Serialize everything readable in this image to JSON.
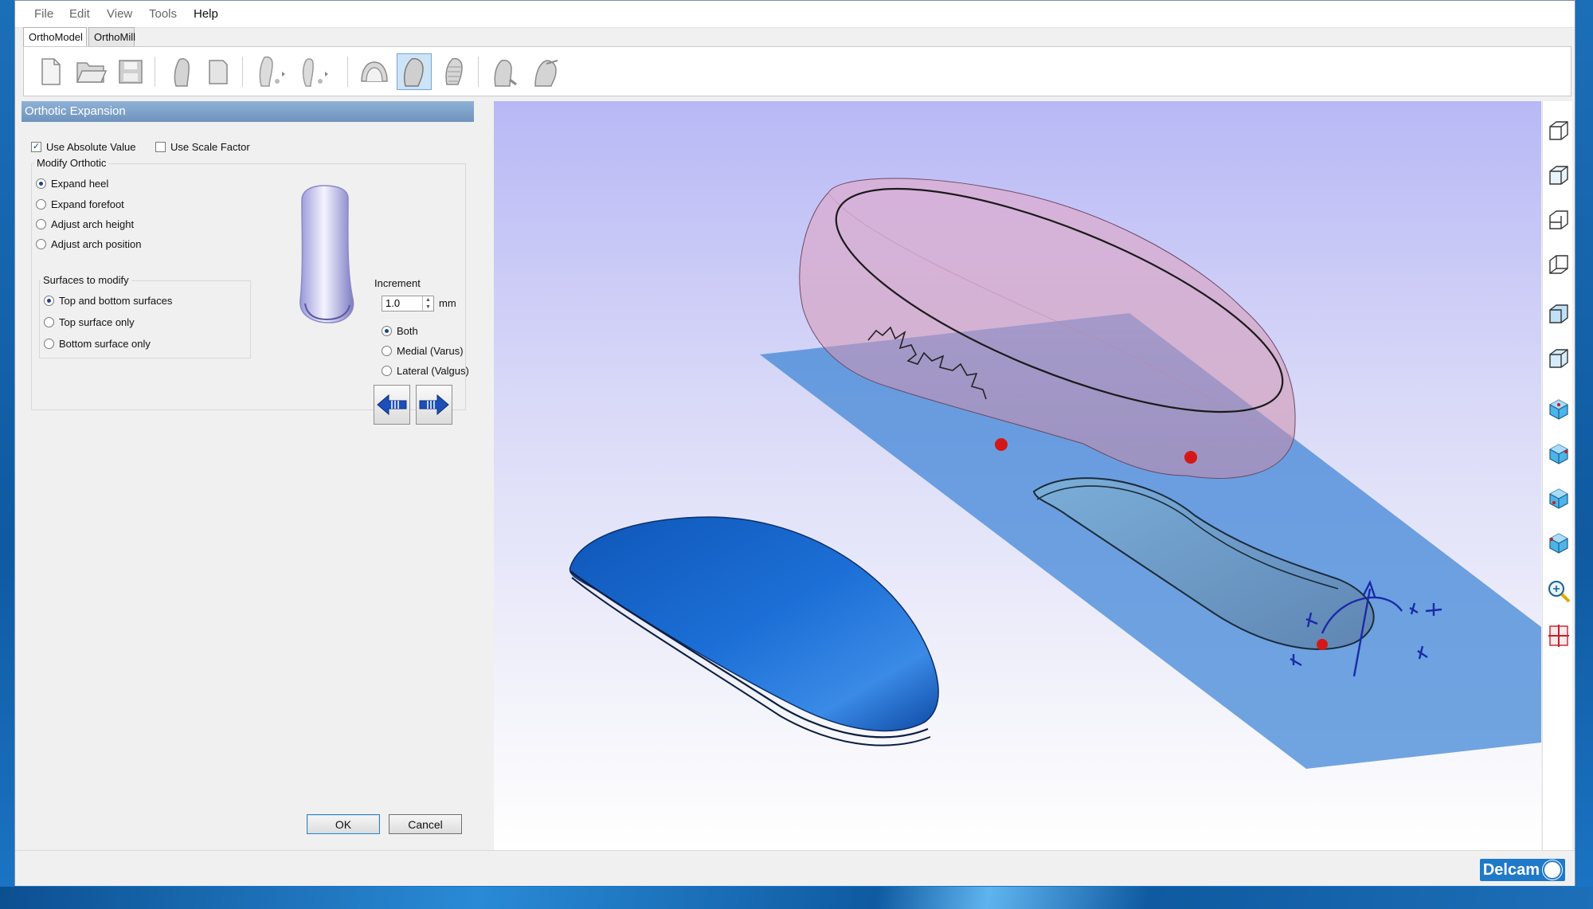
{
  "menu": {
    "items": [
      "File",
      "Edit",
      "View",
      "Tools",
      "Help"
    ]
  },
  "tabs": [
    "OrthoModel",
    "OrthoMill"
  ],
  "toolbar": {
    "buttons": [
      "new-file-icon",
      "open-folder-icon",
      "save-icon",
      "foot-scan-icon",
      "page-icon",
      "foot-side-icon",
      "foot-sole-icon",
      "shell-icon",
      "orthotic-icon",
      "orthotic-grid-icon",
      "heel-tool-icon",
      "heel-post-icon"
    ],
    "active": "orthotic-icon"
  },
  "panel": {
    "title": "Orthotic Expansion",
    "use_absolute_value": {
      "label": "Use Absolute Value",
      "checked": true
    },
    "use_scale_factor": {
      "label": "Use Scale Factor",
      "checked": false
    },
    "modify_orthotic": {
      "label": "Modify Orthotic",
      "options": [
        "Expand heel",
        "Expand forefoot",
        "Adjust arch height",
        "Adjust arch position"
      ],
      "selected": "Expand heel"
    },
    "surfaces": {
      "label": "Surfaces to modify",
      "options": [
        "Top and bottom surfaces",
        "Top surface only",
        "Bottom surface only"
      ],
      "selected": "Top and bottom surfaces"
    },
    "increment": {
      "label": "Increment",
      "value": "1.0",
      "unit": "mm",
      "options": [
        "Both",
        "Medial (Varus)",
        "Lateral (Valgus)"
      ],
      "selected": "Both"
    },
    "ok_label": "OK",
    "cancel_label": "Cancel"
  },
  "view_controls": [
    "view-iso-1-icon",
    "view-iso-2-icon",
    "view-iso-3-icon",
    "view-iso-4-icon",
    "view-front-icon",
    "view-side-icon",
    "cube-top-icon",
    "cube-front-icon",
    "cube-right-icon",
    "cube-left-icon",
    "zoom-fit-icon",
    "section-plane-icon"
  ],
  "brand": {
    "logo_text": "Delcam"
  },
  "colors": {
    "accent": "#1f79c9",
    "panel_title": "#7ea3ca",
    "model_blue": "#1a67c9"
  }
}
